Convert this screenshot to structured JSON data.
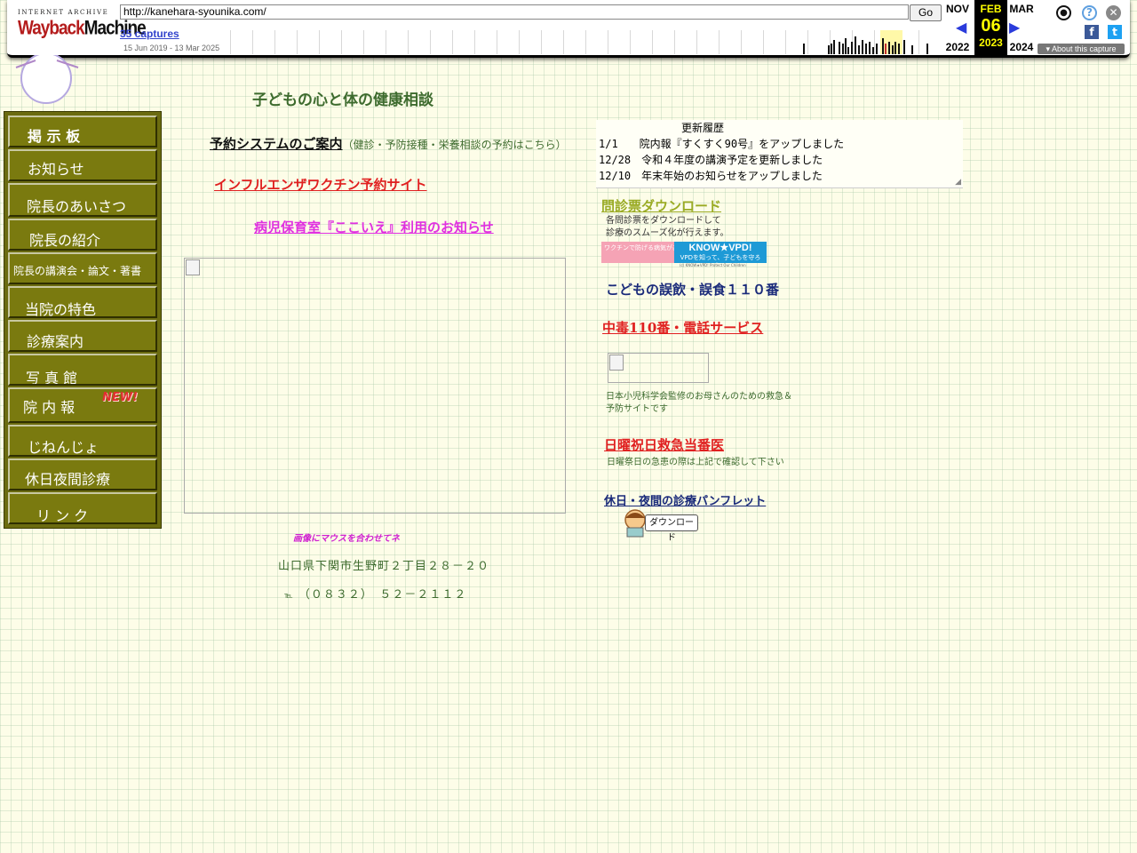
{
  "wayback": {
    "logo_top": "INTERNET ARCHIVE",
    "logo_main_a": "Wayback",
    "logo_main_b": "Machine",
    "url": "http://kanehara-syounika.com/",
    "go_label": "Go",
    "captures": "35 captures",
    "range": "15 Jun 2019 - 13 Mar 2025",
    "prev_month": "NOV",
    "prev_year": "2022",
    "cur_month": "FEB",
    "cur_day": "06",
    "cur_year": "2023",
    "next_month": "MAR",
    "next_year": "2024",
    "about": "About this capture",
    "icons": [
      "user-icon",
      "help-icon",
      "close-icon",
      "facebook-icon",
      "twitter-icon"
    ]
  },
  "page": {
    "heading": "子どもの心と体の健康相談",
    "reservation_link": "予約システムのご案内",
    "reservation_note": "（健診・予防接種・栄養相談の予約はこちら）",
    "flu_link": "インフルエンザワクチン予約サイト",
    "nursery_link": "病児保育室『ここいえ』利用のお知らせ",
    "mouse_hint": "画像にマウスを合わせてネ",
    "address": "山口県下関市生野町２丁目２８－２０",
    "tel_label": "℡",
    "tel": "（０８３２）　５２－２１１２"
  },
  "menu": {
    "items": [
      "掲 示 板",
      "お知らせ",
      "院長のあいさつ",
      "院長の紹介",
      "院長の講演会・論文・著書",
      "当院の特色",
      "診療案内",
      "写 真 館",
      "院 内 報",
      "じねんじょ",
      "休日夜間診療",
      "リ ン ク"
    ],
    "new_badge": "NEW!"
  },
  "history": {
    "title": "更新履歴",
    "lines": [
      "1/1　　院内報『すくすく90号』をアップしました",
      "12/28　令和４年度の講演予定を更新しました",
      "12/10　年末年始のお知らせをアップしました"
    ]
  },
  "right": {
    "questionnaire_link": "問診票ダウンロード",
    "questionnaire_desc1": "各問診票をダウンロードして",
    "questionnaire_desc2": "診療のスムーズ化が行えます。",
    "vpd_left": "ワクチンで防げる病気があります。",
    "vpd_title": "KNOW★VPD!",
    "vpd_sub": "VPDを知って、子どもを守ろう。",
    "vpd_credit": "(c) KNOW★VPD! Protect Our Children",
    "accident_link": "こどもの誤飲・誤食１１０番",
    "poison_link": "中毒110番・電話サービス",
    "jps_desc1": "日本小児科学会監修のお母さんのための救急＆",
    "jps_desc2": "予防サイトです",
    "holiday_link": "日曜祝日救急当番医",
    "holiday_desc": "日曜祭日の急患の際は上記で確認して下さい",
    "pamphlet_link": "休日・夜間の診療パンフレット",
    "download_label": "ダウンロード"
  }
}
